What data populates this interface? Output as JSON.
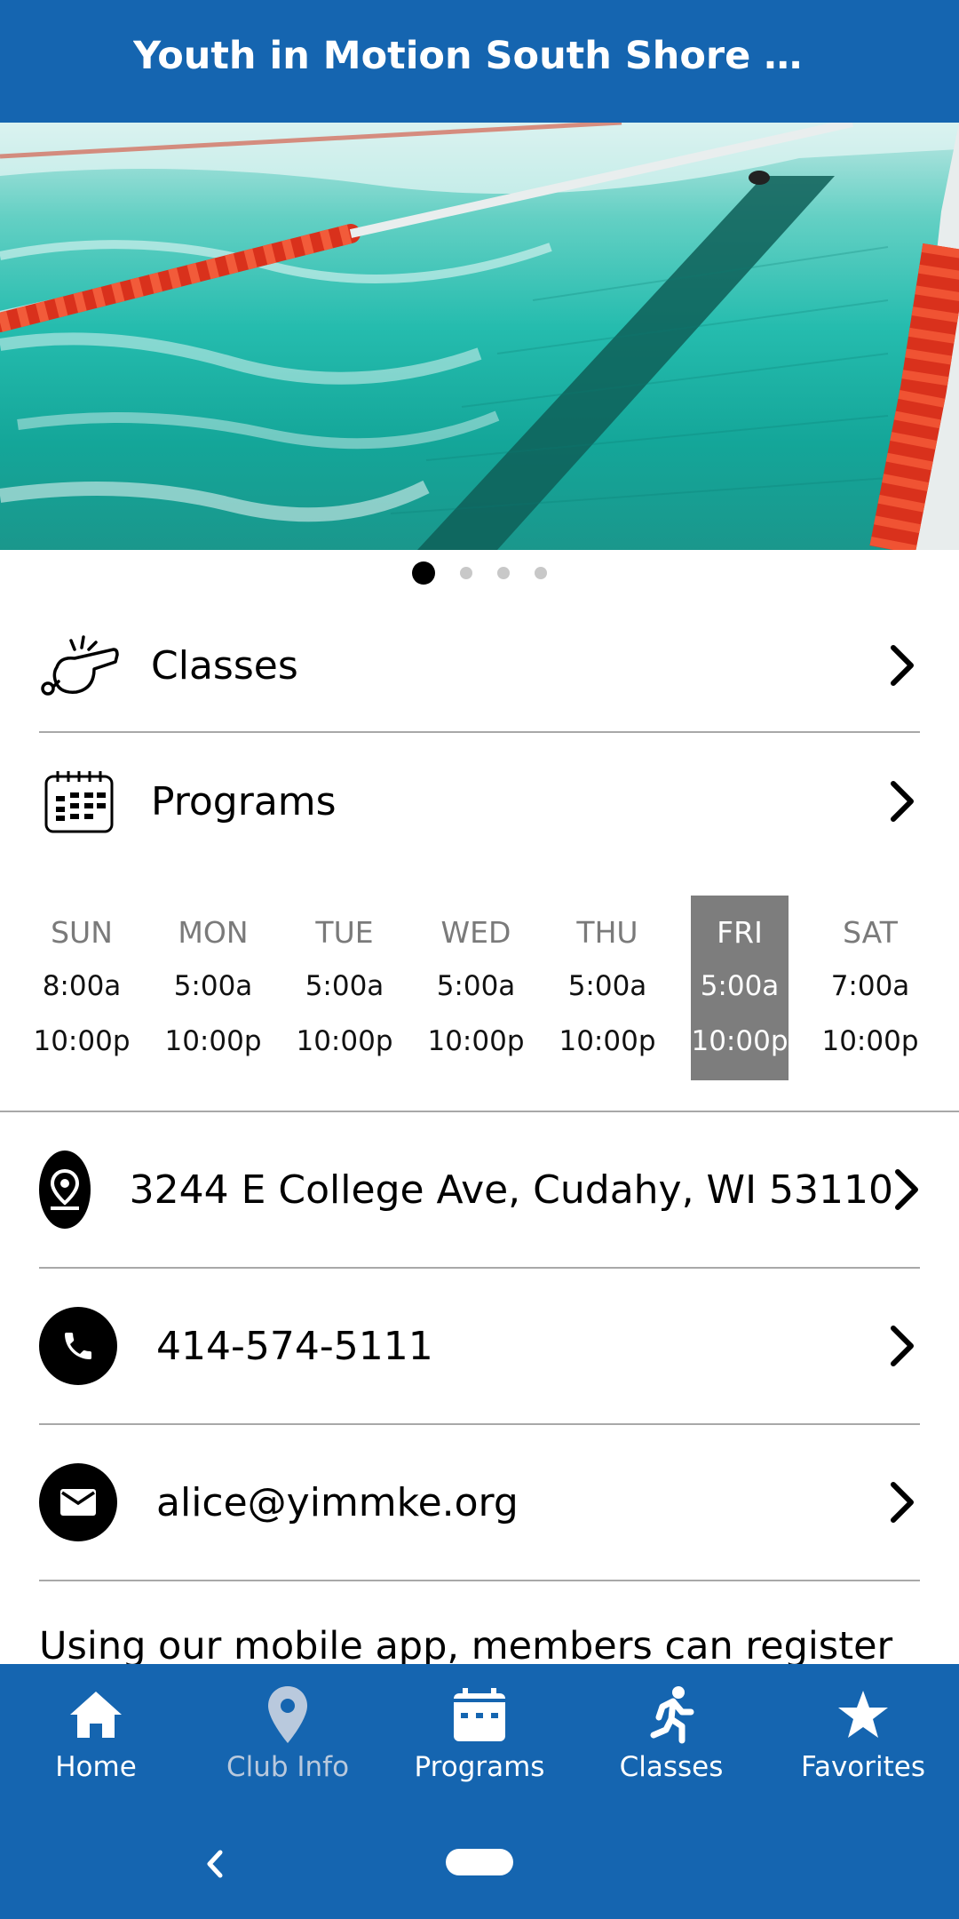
{
  "app_bar": {
    "title": "Youth in Motion South Shore C…"
  },
  "carousel": {
    "total": 4,
    "active_index": 0
  },
  "menu": [
    {
      "label": "Classes",
      "icon": "whistle-icon"
    },
    {
      "label": "Programs",
      "icon": "calendar-grid-icon"
    }
  ],
  "hours": {
    "today_index": 5,
    "days": [
      {
        "day": "SUN",
        "open": "8:00a",
        "close": "10:00p"
      },
      {
        "day": "MON",
        "open": "5:00a",
        "close": "10:00p"
      },
      {
        "day": "TUE",
        "open": "5:00a",
        "close": "10:00p"
      },
      {
        "day": "WED",
        "open": "5:00a",
        "close": "10:00p"
      },
      {
        "day": "THU",
        "open": "5:00a",
        "close": "10:00p"
      },
      {
        "day": "FRI",
        "open": "5:00a",
        "close": "10:00p"
      },
      {
        "day": "SAT",
        "open": "7:00a",
        "close": "10:00p"
      }
    ]
  },
  "contact": {
    "address": "3244 E College Ave, Cudahy, WI 53110",
    "phone": "414-574-5111",
    "email": "alice@yimmke.org"
  },
  "about": {
    "text": "Using our mobile app, members can register"
  },
  "bottom_nav": [
    {
      "label": "Home",
      "icon": "home-icon",
      "active": true
    },
    {
      "label": "Club Info",
      "icon": "location-pin-icon",
      "active": false
    },
    {
      "label": "Programs",
      "icon": "calendar-icon",
      "active": true
    },
    {
      "label": "Classes",
      "icon": "running-person-icon",
      "active": true
    },
    {
      "label": "Favorites",
      "icon": "star-icon",
      "active": true
    }
  ],
  "colors": {
    "brand_blue": "#1565b0",
    "today_highlight": "#7d7d7d",
    "inactive_nav": "#b9c9dd"
  }
}
